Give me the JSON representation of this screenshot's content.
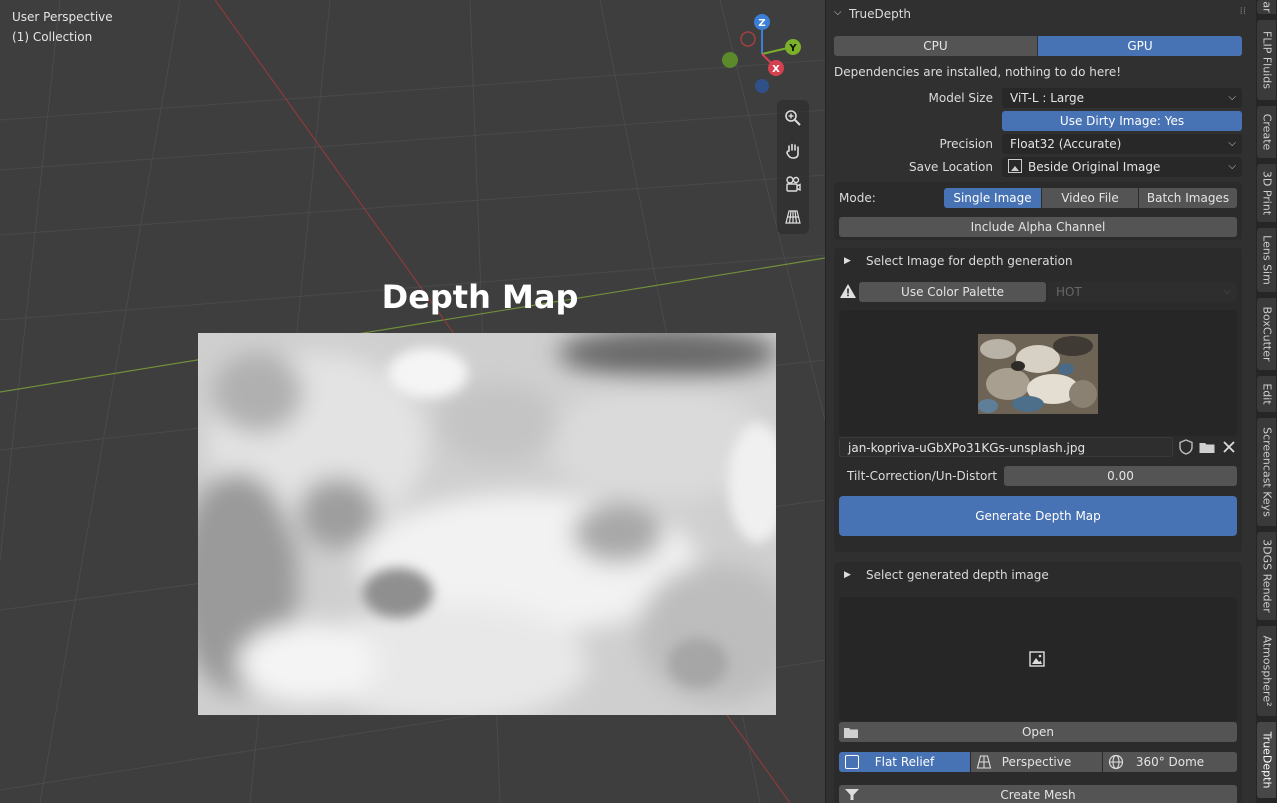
{
  "viewport": {
    "perspective_label": "User Perspective",
    "collection_label": "(1) Collection",
    "image_title": "Depth Map",
    "gizmo": {
      "z": "Z",
      "y": "Y",
      "x": "X"
    }
  },
  "panel": {
    "title": "TrueDepth",
    "device_tabs": [
      "CPU",
      "GPU"
    ],
    "active_device": "GPU",
    "status_text": "Dependencies are installed, nothing to do here!",
    "model_size_label": "Model Size",
    "model_size_value": "ViT-L : Large",
    "dirty_image_button": "Use Dirty Image: Yes",
    "precision_label": "Precision",
    "precision_value": "Float32 (Accurate)",
    "save_location_label": "Save Location",
    "save_location_value": "Beside Original Image",
    "mode_label": "Mode:",
    "mode_tabs": [
      "Single Image",
      "Video File",
      "Batch Images"
    ],
    "active_mode": "Single Image",
    "alpha_button": "Include Alpha Channel",
    "select_image_header": "Select Image for depth generation",
    "color_palette_button": "Use Color Palette",
    "palette_value": "HOT",
    "filename": "jan-kopriva-uGbXPo31KGs-unsplash.jpg",
    "tilt_label": "Tilt-Correction/Un-Distort",
    "tilt_value": "0.00",
    "generate_button": "Generate Depth Map",
    "select_generated_header": "Select generated depth image",
    "open_button": "Open",
    "projection_tabs": [
      "Flat Relief",
      "Perspective",
      "360° Dome"
    ],
    "active_projection": "Flat Relief",
    "create_mesh_button": "Create Mesh"
  },
  "side_tabs": [
    "ar",
    "FLIP Fluids",
    "Create",
    "3D Print",
    "Lens Sim",
    "BoxCutter",
    "Edit",
    "Screencast Keys",
    "3DGS Render",
    "Atmosphere²",
    "TrueDepth"
  ],
  "active_side_tab": "TrueDepth",
  "colors": {
    "accent": "#4772b3",
    "panel_bg": "#303030",
    "viewport_bg": "#3e3e3e"
  }
}
